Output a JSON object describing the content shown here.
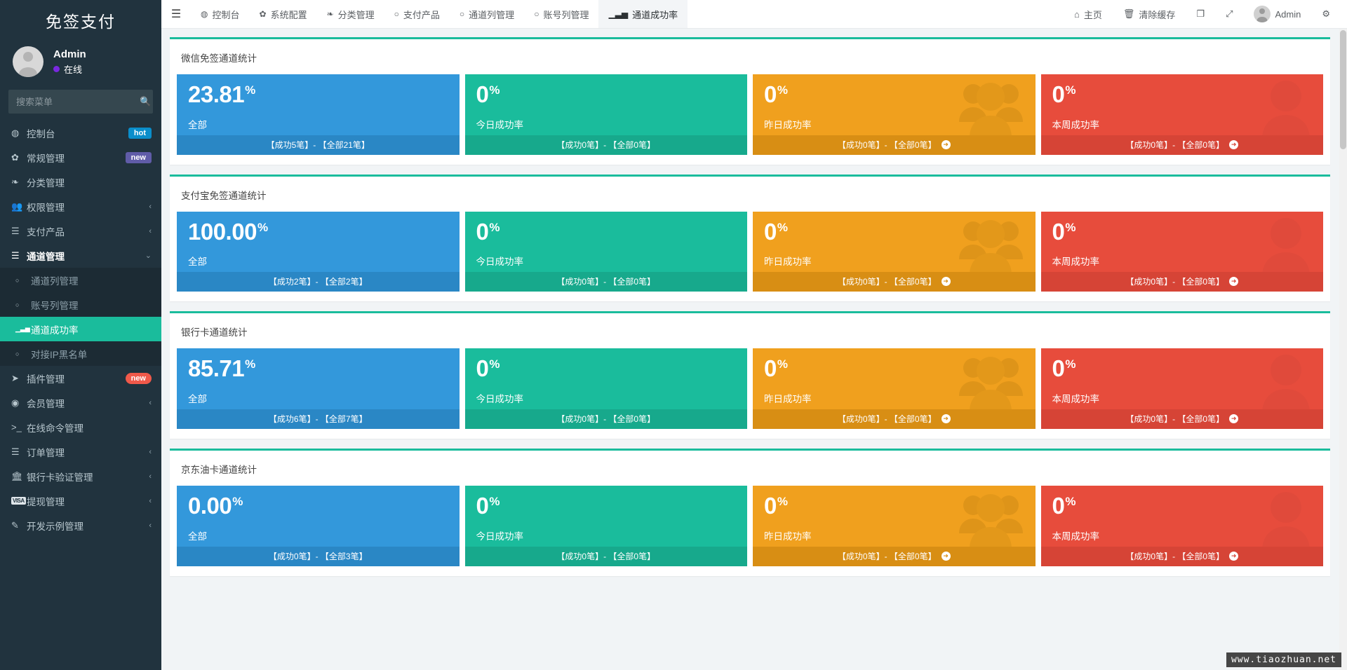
{
  "sidebar": {
    "brand": "免签支付",
    "profile": {
      "name": "Admin",
      "status": "在线"
    },
    "search": {
      "placeholder": "搜索菜单",
      "value": ""
    },
    "items": [
      {
        "label": "控制台",
        "icon": "dashboard-icon",
        "glyph": "◍",
        "badge": "hot",
        "badge_type": "hot"
      },
      {
        "label": "常规管理",
        "icon": "gears-icon",
        "glyph": "✿",
        "badge": "new",
        "badge_type": "new"
      },
      {
        "label": "分类管理",
        "icon": "leaf-icon",
        "glyph": "❧",
        "badge": "",
        "badge_type": ""
      },
      {
        "label": "权限管理",
        "icon": "users-icon",
        "glyph": "👥",
        "chevron": "‹"
      },
      {
        "label": "支付产品",
        "icon": "list-icon",
        "glyph": "☰",
        "chevron": "‹"
      },
      {
        "label": "通道管理",
        "icon": "list-icon",
        "glyph": "☰",
        "chevron": "⌄",
        "expanded": true
      },
      {
        "label": "通道列管理",
        "icon": "circle-icon",
        "glyph": "○",
        "sub": true
      },
      {
        "label": "账号列管理",
        "icon": "circle-icon",
        "glyph": "○",
        "sub": true
      },
      {
        "label": "通道成功率",
        "icon": "bar-chart-icon",
        "glyph": "▁▃▅",
        "sub": true,
        "active": true
      },
      {
        "label": "对接IP黑名单",
        "icon": "circle-icon",
        "glyph": "○",
        "sub": true
      },
      {
        "label": "插件管理",
        "icon": "rocket-icon",
        "glyph": "➤",
        "badge": "new",
        "badge_type": "new-red"
      },
      {
        "label": "会员管理",
        "icon": "user-circle-icon",
        "glyph": "◉",
        "chevron": "‹"
      },
      {
        "label": "在线命令管理",
        "icon": "terminal-icon",
        "glyph": ">_"
      },
      {
        "label": "订单管理",
        "icon": "list-icon",
        "glyph": "☰",
        "chevron": "‹"
      },
      {
        "label": "银行卡验证管理",
        "icon": "bank-icon",
        "glyph": "🏛",
        "chevron": "‹"
      },
      {
        "label": "提现管理",
        "icon": "visa-icon",
        "glyph": "VISA",
        "chevron": "‹"
      },
      {
        "label": "开发示例管理",
        "icon": "magic-wand-icon",
        "glyph": "✎",
        "chevron": "‹"
      }
    ]
  },
  "topbar": {
    "menu_toggle": "☰",
    "nav": [
      {
        "label": "控制台",
        "icon": "dashboard-icon",
        "glyph": "◍",
        "active": false
      },
      {
        "label": "系统配置",
        "icon": "gear-icon",
        "glyph": "✿",
        "active": false
      },
      {
        "label": "分类管理",
        "icon": "leaf-icon",
        "glyph": "❧",
        "active": false
      },
      {
        "label": "支付产品",
        "icon": "circle-icon",
        "glyph": "○",
        "active": false
      },
      {
        "label": "通道列管理",
        "icon": "circle-icon",
        "glyph": "○",
        "active": false
      },
      {
        "label": "账号列管理",
        "icon": "circle-icon",
        "glyph": "○",
        "active": false
      },
      {
        "label": "通道成功率",
        "icon": "bar-chart-icon",
        "glyph": "▁▃▅",
        "active": true
      }
    ],
    "actions": [
      {
        "label": "主页",
        "icon": "home-icon",
        "glyph": "⌂"
      },
      {
        "label": "清除缓存",
        "icon": "trash-icon",
        "glyph": "🗑"
      },
      {
        "label": "",
        "icon": "theme-icon",
        "glyph": "❒"
      },
      {
        "label": "",
        "icon": "fullscreen-icon",
        "glyph": "⤢"
      }
    ],
    "user": "Admin",
    "settings_icon": "gear-settings-icon"
  },
  "panels": [
    {
      "title": "微信免签通道统计",
      "tiles": [
        {
          "value": "23.81",
          "unit": "%",
          "label": "全部",
          "foot": "【成功5笔】- 【全部21笔】",
          "color": "blue",
          "icon": "",
          "has_arrow": false
        },
        {
          "value": "0",
          "unit": "%",
          "label": "今日成功率",
          "foot": "【成功0笔】- 【全部0笔】",
          "color": "green",
          "icon": "",
          "has_arrow": false
        },
        {
          "value": "0",
          "unit": "%",
          "label": "昨日成功率",
          "foot": "【成功0笔】- 【全部0笔】",
          "color": "orange",
          "icon": "group-icon",
          "has_arrow": true
        },
        {
          "value": "0",
          "unit": "%",
          "label": "本周成功率",
          "foot": "【成功0笔】- 【全部0笔】",
          "color": "red",
          "icon": "person-icon",
          "has_arrow": true
        }
      ]
    },
    {
      "title": "支付宝免签通道统计",
      "tiles": [
        {
          "value": "100.00",
          "unit": "%",
          "label": "全部",
          "foot": "【成功2笔】- 【全部2笔】",
          "color": "blue",
          "icon": "",
          "has_arrow": false
        },
        {
          "value": "0",
          "unit": "%",
          "label": "今日成功率",
          "foot": "【成功0笔】- 【全部0笔】",
          "color": "green",
          "icon": "",
          "has_arrow": false
        },
        {
          "value": "0",
          "unit": "%",
          "label": "昨日成功率",
          "foot": "【成功0笔】- 【全部0笔】",
          "color": "orange",
          "icon": "group-icon",
          "has_arrow": true
        },
        {
          "value": "0",
          "unit": "%",
          "label": "本周成功率",
          "foot": "【成功0笔】- 【全部0笔】",
          "color": "red",
          "icon": "person-icon",
          "has_arrow": true
        }
      ]
    },
    {
      "title": "银行卡通道统计",
      "tiles": [
        {
          "value": "85.71",
          "unit": "%",
          "label": "全部",
          "foot": "【成功6笔】- 【全部7笔】",
          "color": "blue",
          "icon": "",
          "has_arrow": false
        },
        {
          "value": "0",
          "unit": "%",
          "label": "今日成功率",
          "foot": "【成功0笔】- 【全部0笔】",
          "color": "green",
          "icon": "",
          "has_arrow": false
        },
        {
          "value": "0",
          "unit": "%",
          "label": "昨日成功率",
          "foot": "【成功0笔】- 【全部0笔】",
          "color": "orange",
          "icon": "group-icon",
          "has_arrow": true
        },
        {
          "value": "0",
          "unit": "%",
          "label": "本周成功率",
          "foot": "【成功0笔】- 【全部0笔】",
          "color": "red",
          "icon": "person-icon",
          "has_arrow": true
        }
      ]
    },
    {
      "title": "京东油卡通道统计",
      "tiles": [
        {
          "value": "0.00",
          "unit": "%",
          "label": "全部",
          "foot": "【成功0笔】- 【全部3笔】",
          "color": "blue",
          "icon": "",
          "has_arrow": false
        },
        {
          "value": "0",
          "unit": "%",
          "label": "今日成功率",
          "foot": "【成功0笔】- 【全部0笔】",
          "color": "green",
          "icon": "",
          "has_arrow": false
        },
        {
          "value": "0",
          "unit": "%",
          "label": "昨日成功率",
          "foot": "【成功0笔】- 【全部0笔】",
          "color": "orange",
          "icon": "group-icon",
          "has_arrow": true
        },
        {
          "value": "0",
          "unit": "%",
          "label": "本周成功率",
          "foot": "【成功0笔】- 【全部0笔】",
          "color": "red",
          "icon": "person-icon",
          "has_arrow": true
        }
      ]
    }
  ],
  "watermark": "www.tiaozhuan.net",
  "colors": {
    "sidebar_bg": "#21333e",
    "active_green": "#1abc9c",
    "tile_blue": "#3398db",
    "tile_green": "#1abc9c",
    "tile_orange": "#f0a01e",
    "tile_red": "#e74c3c"
  }
}
